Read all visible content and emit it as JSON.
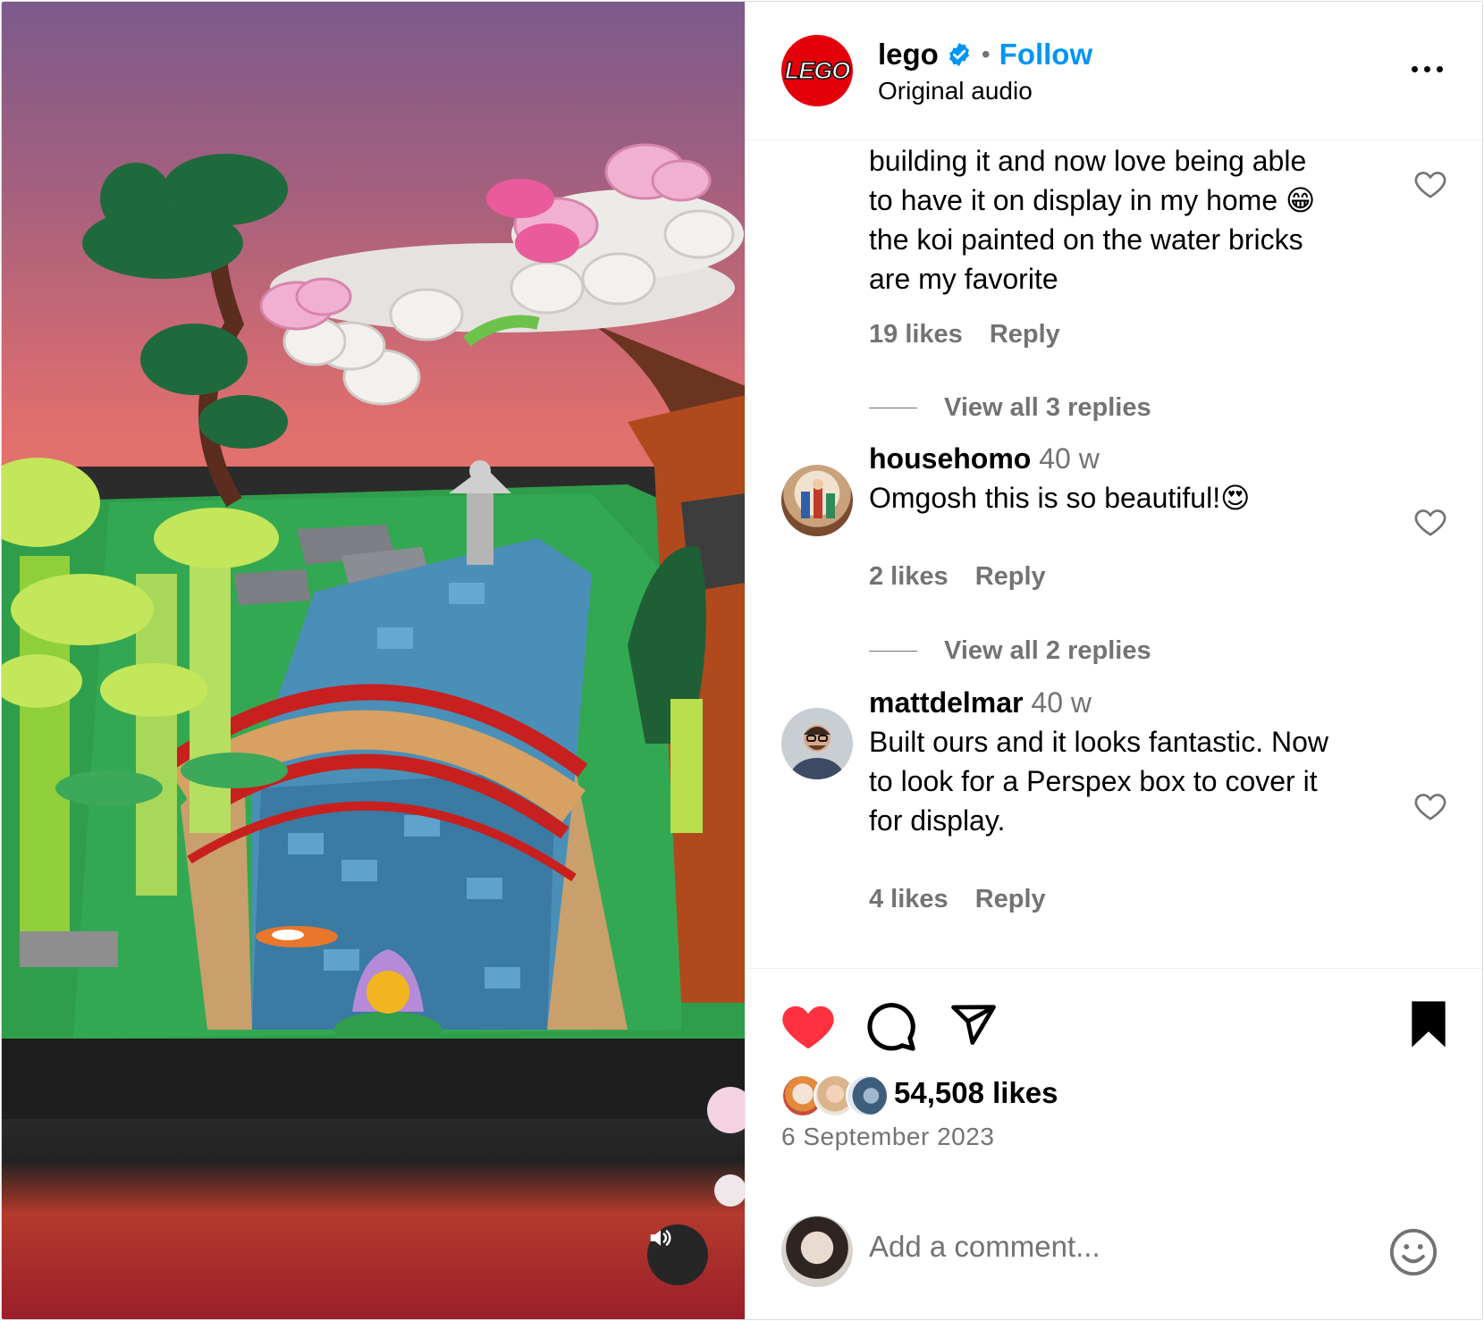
{
  "post": {
    "username": "lego",
    "follow_label": "Follow",
    "dot": "•",
    "audio": "Original audio",
    "logo_text": "LEGO",
    "icons": {
      "verified": "verified-badge-icon",
      "more": "more-options-icon",
      "mute": "speaker-icon"
    },
    "colors": {
      "brand": "#e3000b",
      "follow": "#0095f6",
      "heart": "#ff3040"
    }
  },
  "comments": [
    {
      "text_lines": [
        "building it and now love being able",
        "to have it on display in my home 😁",
        "the koi painted on the water bricks",
        "are my favorite"
      ],
      "likes": "19 likes",
      "reply": "Reply",
      "view_replies": "View all 3 replies"
    },
    {
      "user": "househomo",
      "time": "40 w",
      "text": "Omgosh this is so beautiful!😍",
      "likes": "2 likes",
      "reply": "Reply",
      "view_replies": "View all 2 replies"
    },
    {
      "user": "mattdelmar",
      "time": "40 w",
      "text_lines": [
        "Built ours and it looks fantastic. Now",
        "to look for a Perspex box to cover it",
        "for display."
      ],
      "likes": "4 likes",
      "reply": "Reply"
    }
  ],
  "actions": {
    "likes": "54,508 likes",
    "date": "6 September 2023",
    "icons": [
      "heart-filled-icon",
      "comment-icon",
      "share-icon",
      "bookmark-filled-icon"
    ]
  },
  "add_comment": {
    "placeholder": "Add a comment...",
    "emoji_icon": "emoji-icon"
  }
}
